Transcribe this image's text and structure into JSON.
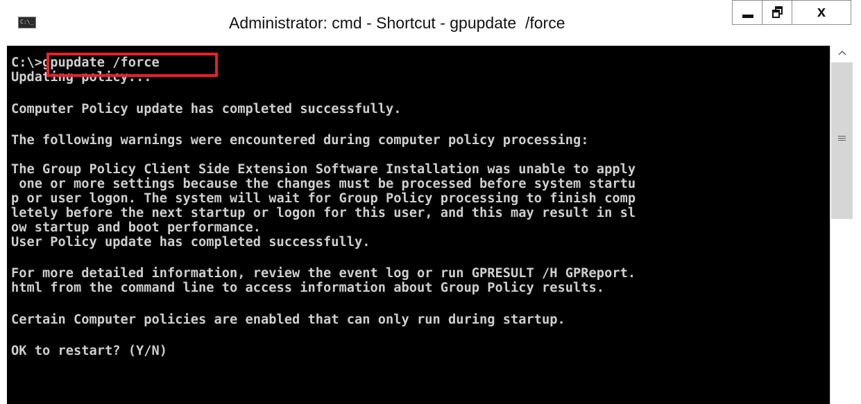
{
  "window": {
    "title": "Administrator: cmd - Shortcut - gpupdate  /force",
    "icon": "console-app-icon",
    "icon_text": "C:\\_",
    "minimize_label": "minimize",
    "maximize_label": "maximize",
    "close_label": "x"
  },
  "console": {
    "lines": [
      "C:\\>gpupdate /force",
      "Updating policy...",
      "",
      "Computer Policy update has completed successfully.",
      "",
      "The following warnings were encountered during computer policy processing:",
      "",
      "The Group Policy Client Side Extension Software Installation was unable to apply",
      " one or more settings because the changes must be processed before system startu",
      "p or user logon. The system will wait for Group Policy processing to finish comp",
      "letely before the next startup or logon for this user, and this may result in sl",
      "ow startup and boot performance.",
      "User Policy update has completed successfully.",
      "",
      "For more detailed information, review the event log or run GPRESULT /H GPReport.",
      "html from the command line to access information about Group Policy results.",
      "",
      "Certain Computer policies are enabled that can only run during startup.",
      "",
      "OK to restart? (Y/N)"
    ],
    "highlight_color": "#e8202a",
    "background_color": "#000000",
    "text_color": "#cfcfcf"
  }
}
